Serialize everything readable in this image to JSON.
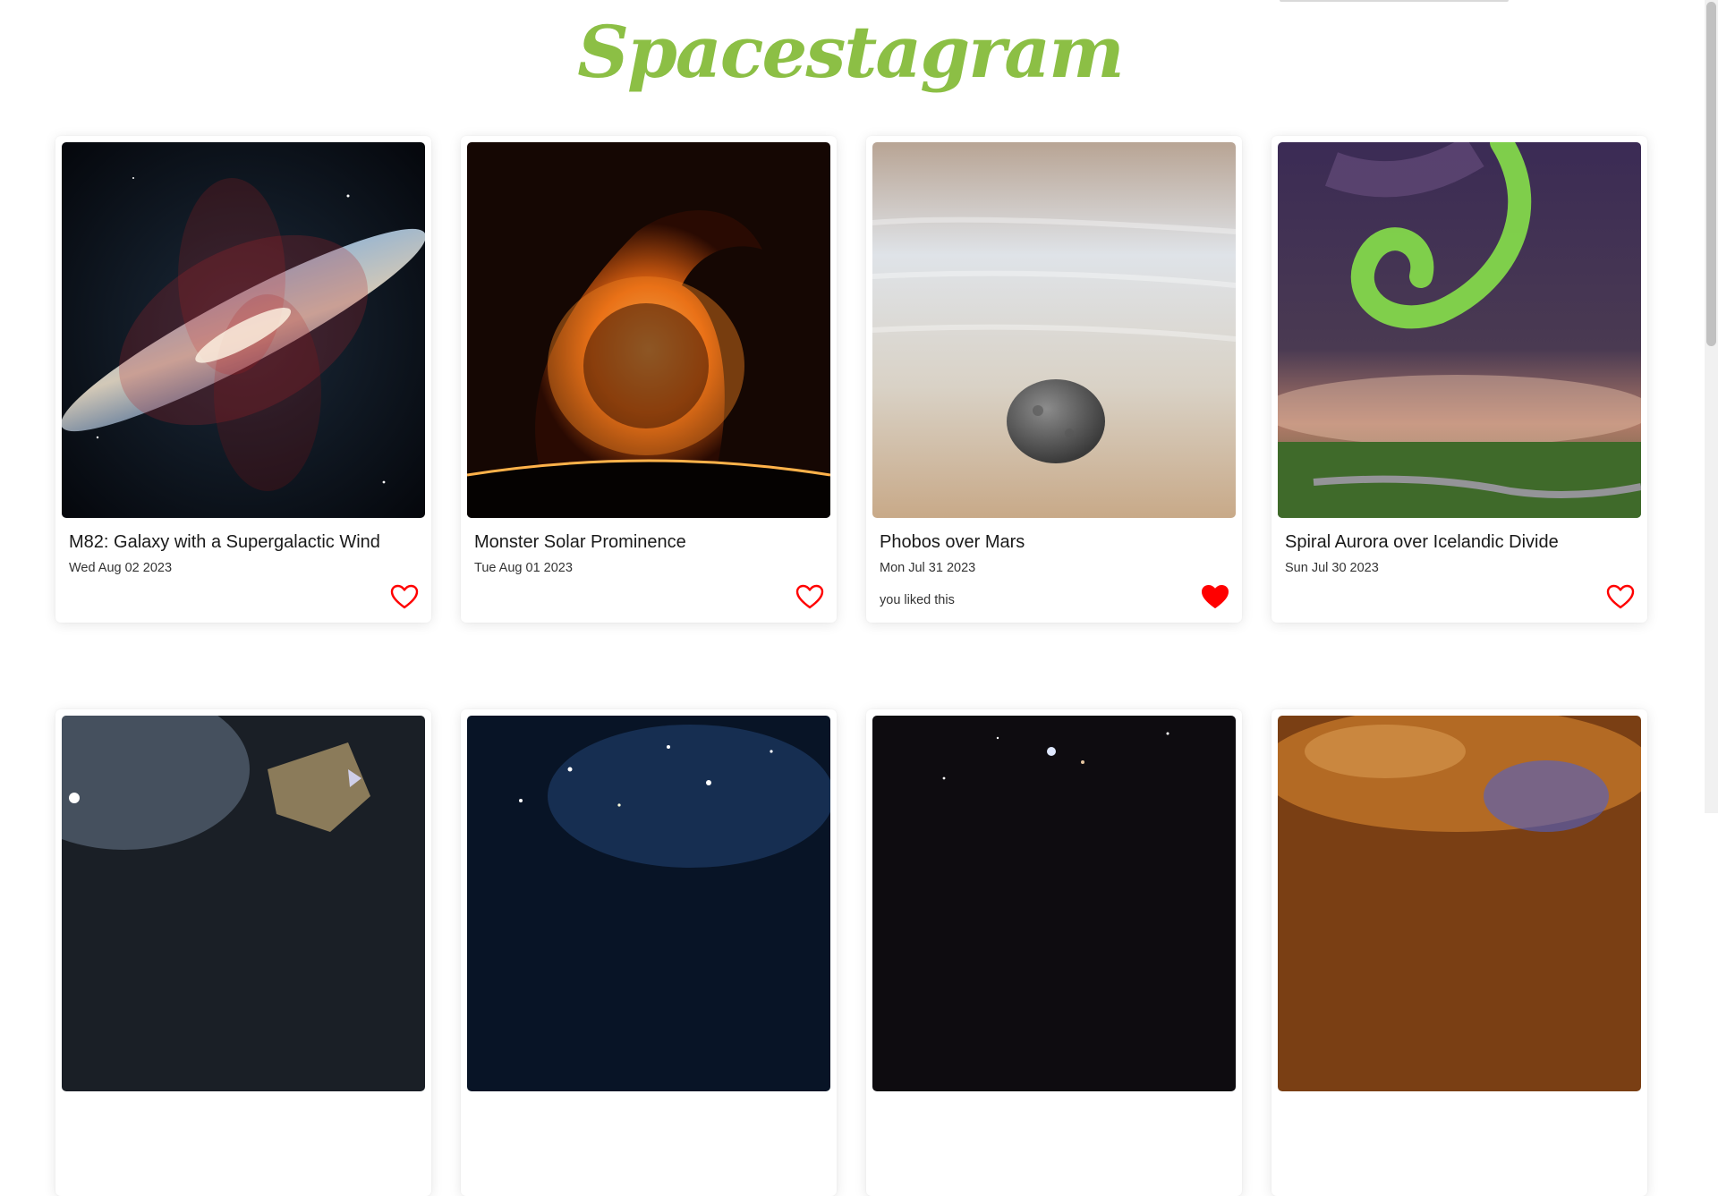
{
  "app": {
    "logo": "Spacestagram"
  },
  "colors": {
    "brand": "#8cbf45",
    "heart": "#ff0000"
  },
  "posts": [
    {
      "title": "M82: Galaxy with a Supergalactic Wind",
      "date": "Wed Aug 02 2023",
      "liked": false,
      "liked_text": ""
    },
    {
      "title": "Monster Solar Prominence",
      "date": "Tue Aug 01 2023",
      "liked": false,
      "liked_text": ""
    },
    {
      "title": "Phobos over Mars",
      "date": "Mon Jul 31 2023",
      "liked": true,
      "liked_text": "you liked this"
    },
    {
      "title": "Spiral Aurora over Icelandic Divide",
      "date": "Sun Jul 30 2023",
      "liked": false,
      "liked_text": ""
    }
  ],
  "icons": {
    "like": "heart-outline-icon",
    "liked": "heart-filled-icon"
  }
}
